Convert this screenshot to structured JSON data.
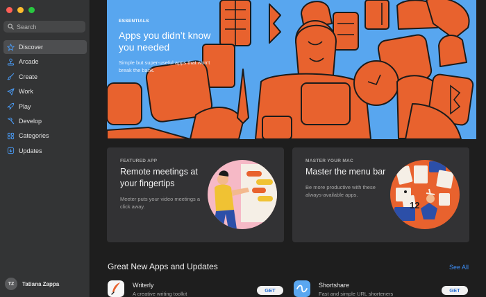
{
  "window": {
    "controls": {
      "close_color": "#fe5f57",
      "minimize_color": "#febc2e",
      "zoom_color": "#28c840"
    }
  },
  "sidebar": {
    "search": {
      "placeholder": "Search"
    },
    "items": [
      {
        "label": "Discover",
        "icon": "star-icon",
        "active": true
      },
      {
        "label": "Arcade",
        "icon": "joystick-icon",
        "active": false
      },
      {
        "label": "Create",
        "icon": "brush-icon",
        "active": false
      },
      {
        "label": "Work",
        "icon": "paper-plane-icon",
        "active": false
      },
      {
        "label": "Play",
        "icon": "rocket-icon",
        "active": false
      },
      {
        "label": "Develop",
        "icon": "hammer-icon",
        "active": false
      },
      {
        "label": "Categories",
        "icon": "grid-icon",
        "active": false
      },
      {
        "label": "Updates",
        "icon": "download-icon",
        "active": false
      }
    ],
    "user": {
      "initials": "TZ",
      "name": "Tatiana Zappa"
    }
  },
  "hero": {
    "eyebrow": "ESSENTIALS",
    "title": "Apps you didn’t know you needed",
    "description": "Simple but super-useful apps that won’t break the bank.",
    "background": "#58a6ef",
    "art_color": "#e8622e"
  },
  "cards": [
    {
      "eyebrow": "FEATURED APP",
      "title": "Remote meetings at your fingertips",
      "description": "Meeter puts your video meetings a click away."
    },
    {
      "eyebrow": "MASTER YOUR MAC",
      "title": "Master the menu bar",
      "description": "Be more productive with these always-available apps.",
      "art_number": "12"
    }
  ],
  "section": {
    "title": "Great New Apps and Updates",
    "see_all": "See All"
  },
  "apps": [
    {
      "name": "Writerly",
      "subtitle": "A creative writing toolkit",
      "button": "GET",
      "icon": "quill-icon"
    },
    {
      "name": "Shortshare",
      "subtitle": "Fast and simple URL shorteners",
      "button": "GET",
      "icon": "link-icon"
    }
  ],
  "colors": {
    "accent": "#3d8ef7",
    "sidebar": "#333435",
    "content": "#1e1e1e",
    "card": "#323234"
  }
}
